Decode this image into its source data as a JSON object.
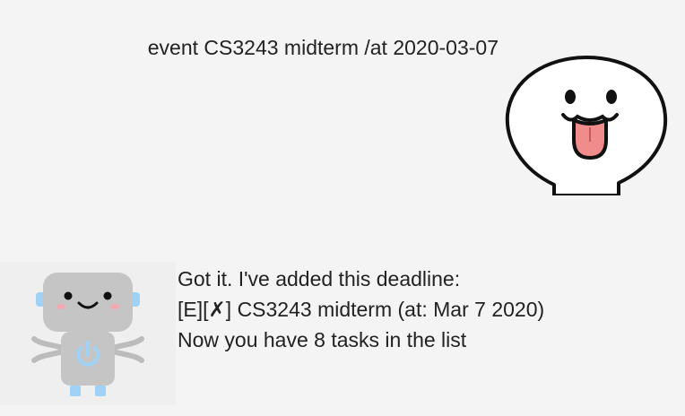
{
  "user_message": {
    "text": "event CS3243 midterm /at 2020-03-07",
    "avatar_icon": "tongue-out-face-icon"
  },
  "bot_message": {
    "lines": [
      "Got it. I've added this deadline:",
      "[E][✗] CS3243 midterm (at: Mar 7 2020)",
      "Now you have 8 tasks in the list"
    ],
    "avatar_icon": "robot-icon"
  },
  "colors": {
    "background": "#f4f4f4",
    "bot_avatar_bg": "#efefef",
    "robot_body": "#c5c5c5",
    "robot_accent": "#9fd2f5",
    "tongue": "#f08c8c"
  }
}
